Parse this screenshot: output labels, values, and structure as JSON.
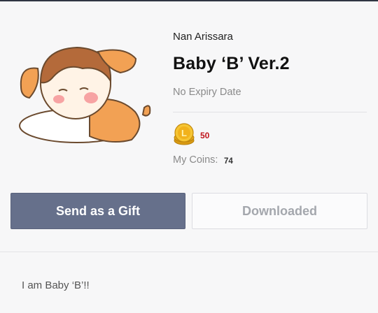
{
  "sticker": {
    "creator": "Nan Arissara",
    "title": "Baby ‘B’ Ver.2",
    "expiry": "No Expiry Date",
    "price": "50",
    "my_coins_label": "My Coins:",
    "my_coins_value": "74",
    "description": "I am Baby ‘B’!!"
  },
  "buttons": {
    "gift_label": "Send as a Gift",
    "downloaded_label": "Downloaded"
  },
  "colors": {
    "gift_button": "#66708b",
    "price_text": "#c0141c",
    "coin_gold": "#f2b21c"
  },
  "icons": {
    "thumbnail": "sleeping-baby-sticker",
    "coin": "gold-coin-icon"
  }
}
